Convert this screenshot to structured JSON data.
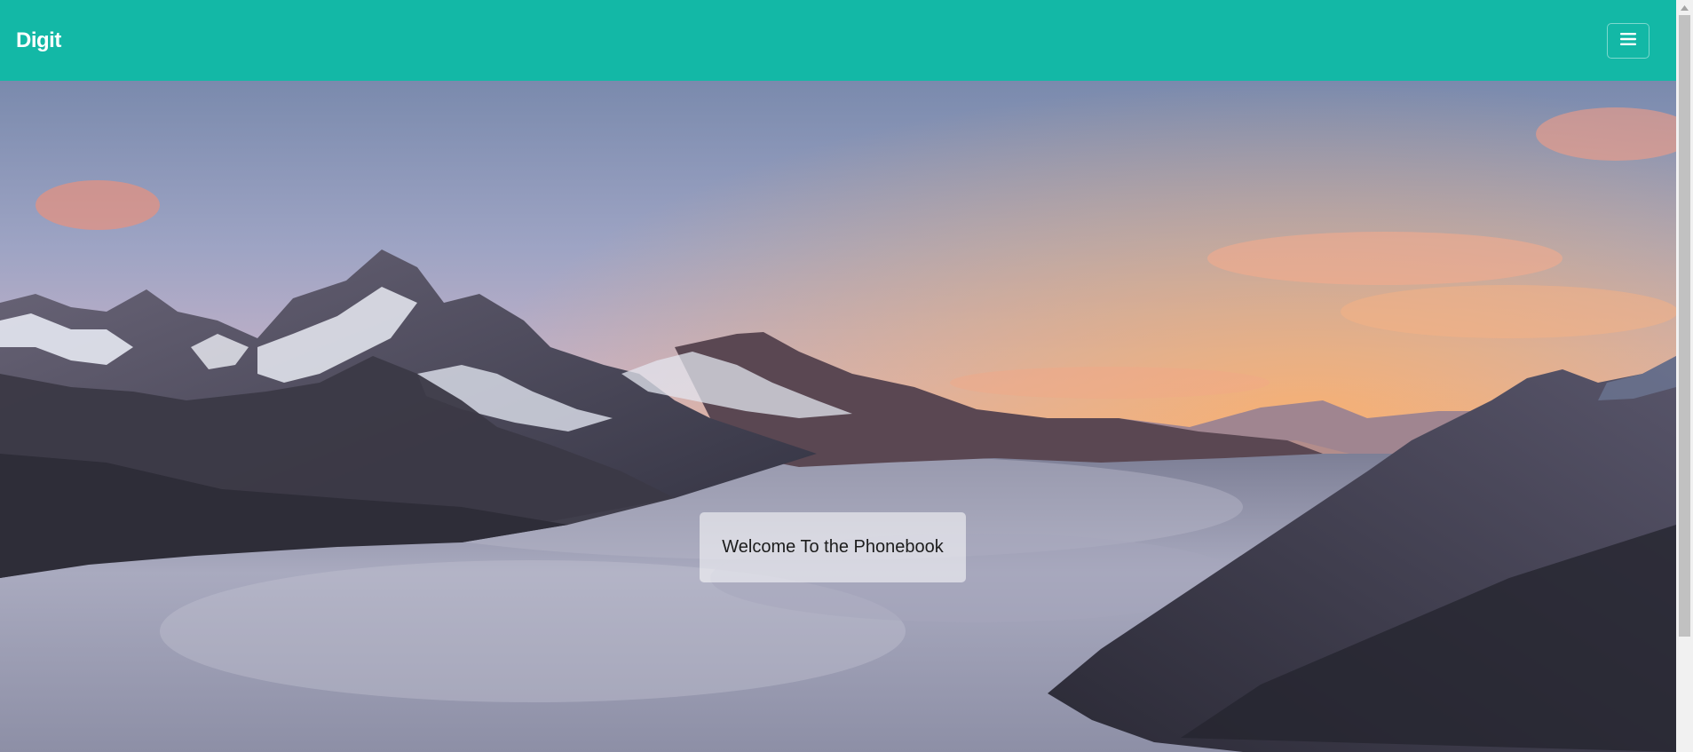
{
  "navbar": {
    "brand": "Digit",
    "menu_icon": "hamburger-menu-icon"
  },
  "hero": {
    "welcome_text": "Welcome To the Phonebook",
    "background": "mountain-sunset-above-clouds-image"
  },
  "colors": {
    "navbar": "#13b8a6",
    "brand_text": "#ffffff",
    "welcome_box": "rgba(255,255,255,0.55)"
  }
}
